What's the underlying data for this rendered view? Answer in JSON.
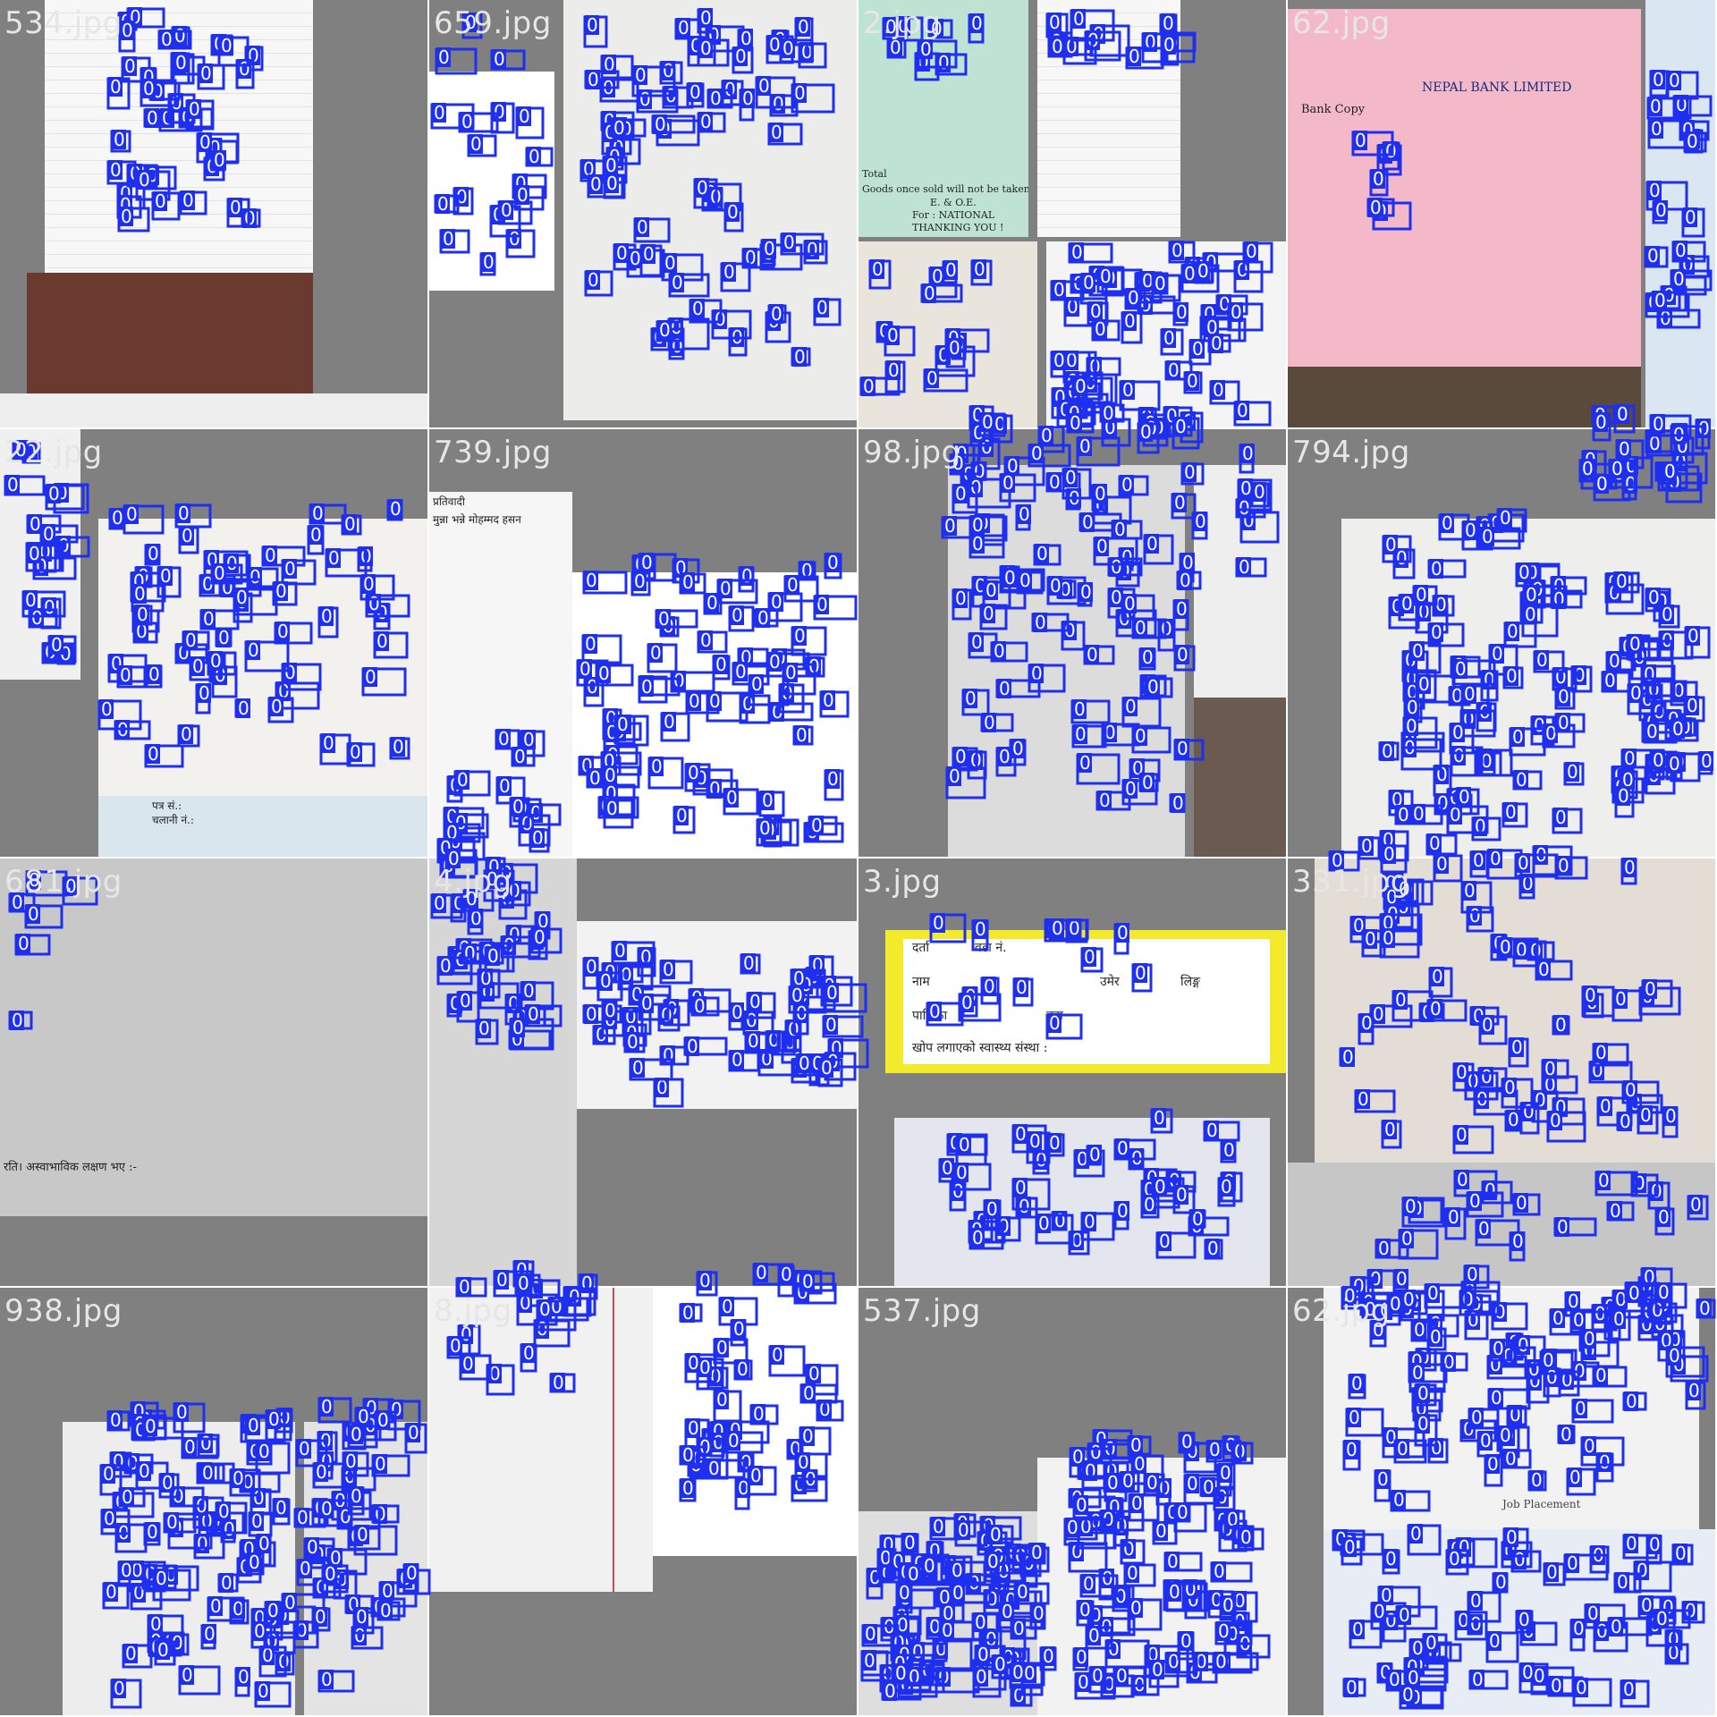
{
  "tiles": [
    {
      "label": "534.jpg"
    },
    {
      "label": "659.jpg"
    },
    {
      "label": "2.jpg"
    },
    {
      "label": "62.jpg"
    },
    {
      "label": "22.jpg"
    },
    {
      "label": "739.jpg"
    },
    {
      "label": "98.jpg"
    },
    {
      "label": "794.jpg"
    },
    {
      "label": "681.jpg"
    },
    {
      "label": "4.jpg"
    },
    {
      "label": "3.jpg"
    },
    {
      "label": "331.jpg"
    },
    {
      "label": "938.jpg"
    },
    {
      "label": "8.jpg"
    },
    {
      "label": "537.jpg"
    },
    {
      "label": "62.jpg"
    }
  ],
  "box_class_label": "0",
  "texts": {
    "bank_copy": "Bank Copy",
    "bank_name": "NEPAL BANK LIMITED",
    "goods_note": "Goods once sold will not be taken back.",
    "eoe": "E. & O.E.",
    "for_national": "For : NATIONAL",
    "thanking": "THANKING YOU !",
    "total": "Total",
    "pratibadi": "प्रतिवादी",
    "mohammad": "मुन्ना भन्ने मोहम्मद हसन",
    "patra_san": "पत्र सं.:",
    "chalani": "चलानी नं.:",
    "asvabhabik": "रति। अस्वाभाविक लक्षण भए :-",
    "darta": "दर्ता",
    "ward": "वडा नं.",
    "naam": "नाम",
    "umer": "उमेर",
    "ling": "लिङ्ग",
    "palika": "पालिका",
    "wada": "वडा",
    "khop": "खोप लगाएको स्वास्थ्य संस्था :",
    "job_placement": "Job Placement"
  },
  "colors": {
    "box": "#1e2ff0",
    "background": "#808080",
    "label_text": "#e6e6e6"
  }
}
